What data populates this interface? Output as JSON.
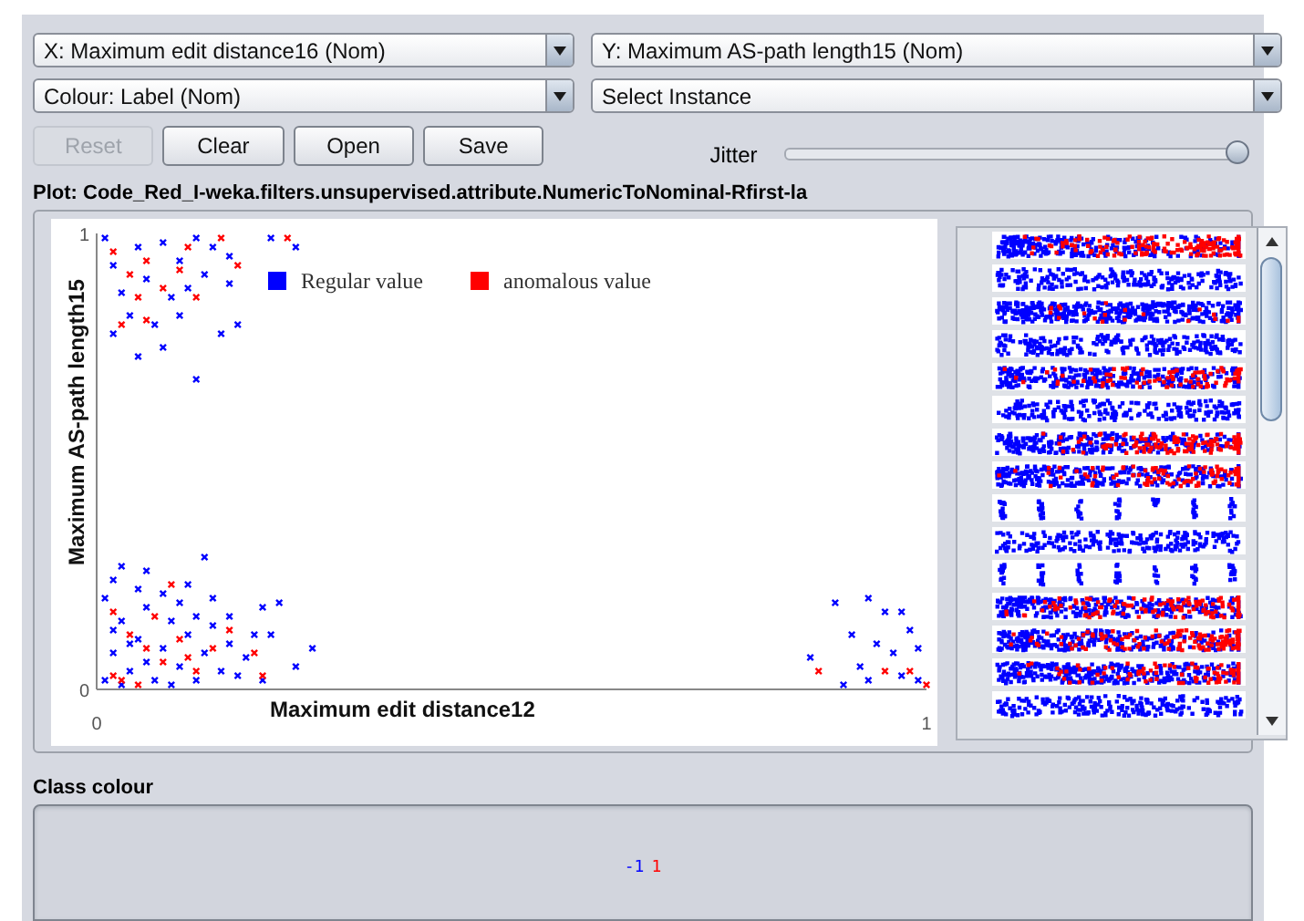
{
  "x_selector": {
    "value": "X: Maximum edit distance16 (Nom)"
  },
  "y_selector": {
    "value": "Y: Maximum AS-path length15 (Nom)"
  },
  "colour_selector": {
    "value": "Colour: Label (Nom)"
  },
  "instance_selector": {
    "value": "Select Instance"
  },
  "buttons": [
    {
      "label": "Reset",
      "disabled": true
    },
    {
      "label": "Clear",
      "disabled": false
    },
    {
      "label": "Open",
      "disabled": false
    },
    {
      "label": "Save",
      "disabled": false
    }
  ],
  "jitter": {
    "label": "Jitter",
    "level": 1
  },
  "plot": {
    "title": "Plot: Code_Red_I-weka.filters.unsupervised.attribute.NumericToNominal-Rfirst-la",
    "chart_data": {
      "type": "scatter",
      "xlabel": "Maximum edit distance12",
      "ylabel": "Maximum AS-path length15",
      "xlim": [
        0,
        1
      ],
      "ylim": [
        0,
        1
      ],
      "xticks": [
        0,
        1
      ],
      "yticks": [
        0,
        1
      ],
      "legend": true,
      "series": [
        {
          "name": "Regular value",
          "color": "#0000ff",
          "x": [
            0.01,
            0.02,
            0.03,
            0.01,
            0.04,
            0.05,
            0.06,
            0.02,
            0.07,
            0.08,
            0.09,
            0.03,
            0.1,
            0.11,
            0.12,
            0.13,
            0.14,
            0.05,
            0.15,
            0.16,
            0.17,
            0.18,
            0.19,
            0.08,
            0.1,
            0.2,
            0.14,
            0.04,
            0.06,
            0.12,
            0.16,
            0.02,
            0.09,
            0.06,
            0.13,
            0.2,
            0.22,
            0.21,
            0.26,
            0.24,
            0.03,
            0.11,
            0.01,
            0.02,
            0.03,
            0.05,
            0.06,
            0.08,
            0.09,
            0.04,
            0.1,
            0.11,
            0.07,
            0.12,
            0.13,
            0.14,
            0.16,
            0.08,
            0.02,
            0.15,
            0.1,
            0.16,
            0.21,
            0.24,
            0.12,
            0.17,
            0.05,
            0.89,
            0.93,
            0.95,
            0.91,
            0.94,
            0.92,
            0.96,
            0.98,
            0.99,
            0.97,
            0.9,
            0.99,
            0.93,
            0.86,
            0.97
          ],
          "values": [
            0.02,
            0.08,
            0.15,
            0.2,
            0.04,
            0.11,
            0.18,
            0.24,
            0.02,
            0.09,
            0.15,
            0.27,
            0.05,
            0.12,
            0.02,
            0.08,
            0.14,
            0.22,
            0.04,
            0.1,
            0.03,
            0.07,
            0.12,
            0.21,
            0.19,
            0.02,
            0.2,
            0.1,
            0.06,
            0.16,
            0.16,
            0.13,
            0.01,
            0.26,
            0.29,
            0.18,
            0.19,
            0.12,
            0.09,
            0.05,
            0.01,
            0.23,
            0.99,
            0.93,
            0.87,
            0.97,
            0.9,
            0.98,
            0.86,
            0.82,
            0.94,
            0.88,
            0.8,
            0.99,
            0.91,
            0.97,
            0.89,
            0.75,
            0.78,
            0.78,
            0.82,
            0.95,
            0.99,
            0.97,
            0.68,
            0.8,
            0.73,
            0.19,
            0.2,
            0.17,
            0.12,
            0.1,
            0.05,
            0.08,
            0.13,
            0.09,
            0.03,
            0.01,
            0.02,
            0.02,
            0.07,
            0.17
          ]
        },
        {
          "name": "anomalous value",
          "color": "#ff0000",
          "x": [
            0.02,
            0.03,
            0.05,
            0.04,
            0.08,
            0.1,
            0.12,
            0.07,
            0.09,
            0.02,
            0.14,
            0.11,
            0.16,
            0.19,
            0.2,
            0.06,
            0.02,
            0.04,
            0.06,
            0.08,
            0.05,
            0.1,
            0.11,
            0.03,
            0.06,
            0.15,
            0.12,
            0.17,
            0.23,
            0.87,
            0.95,
            0.98,
            1.0
          ],
          "values": [
            0.03,
            0.02,
            0.01,
            0.12,
            0.06,
            0.11,
            0.04,
            0.16,
            0.23,
            0.17,
            0.09,
            0.07,
            0.13,
            0.08,
            0.03,
            0.09,
            0.96,
            0.91,
            0.94,
            0.88,
            0.86,
            0.92,
            0.97,
            0.8,
            0.81,
            0.99,
            0.86,
            0.93,
            0.99,
            0.04,
            0.04,
            0.04,
            0.01
          ]
        }
      ]
    }
  },
  "class_colour": {
    "title": "Class colour",
    "classes": [
      {
        "label": "-1",
        "color": "#0000ff"
      },
      {
        "label": "1",
        "color": "#ff0000"
      }
    ]
  }
}
